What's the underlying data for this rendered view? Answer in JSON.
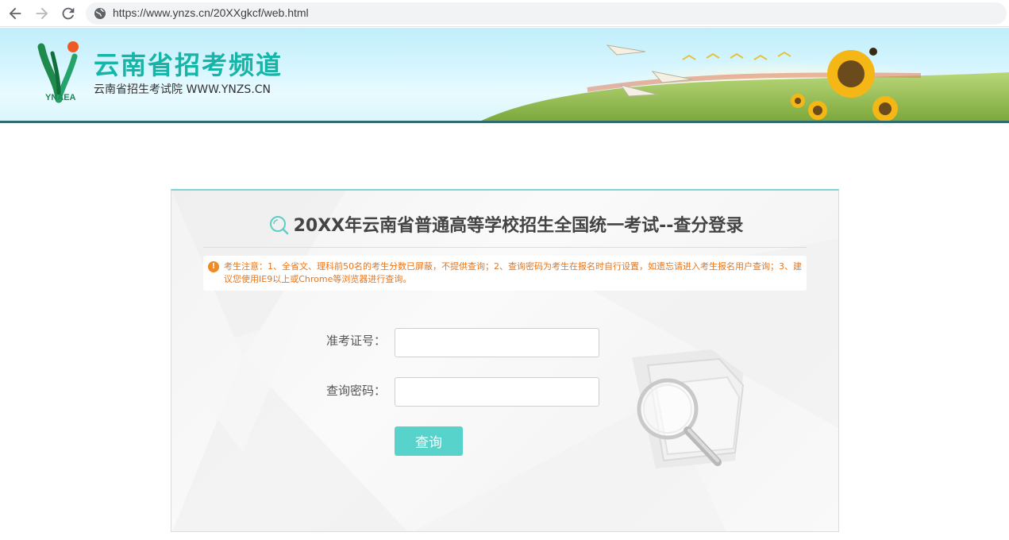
{
  "browser": {
    "url": "https://www.ynzs.cn/20XXgkcf/web.html"
  },
  "header": {
    "site_title": "云南省招考频道",
    "site_subtitle": "云南省招生考试院 WWW.YNZS.CN",
    "logo_text": "YNAEA"
  },
  "panel": {
    "title": "20XX年云南省普通高等学校招生全国统一考试--查分登录",
    "notice": "考生注意：1、全省文、理科前50名的考生分数已屏蔽，不提供查询；2、查询密码为考生在报名时自行设置，如遗忘请进入考生报名用户查询；3、建议您使用IE9以上或Chrome等浏览器进行查询。",
    "exam_id_label": "准考证号：",
    "exam_id_value": "",
    "password_label": "查询密码：",
    "password_value": "",
    "submit_label": "查询"
  },
  "colors": {
    "accent": "#57d3cc",
    "title_teal": "#16b5a7",
    "notice_orange": "#e8751a",
    "banner_line": "#2f6b6f"
  },
  "icons": [
    "back-arrow-icon",
    "forward-arrow-icon",
    "reload-icon",
    "globe-icon",
    "search-icon",
    "warning-icon",
    "magnifier-icon"
  ]
}
